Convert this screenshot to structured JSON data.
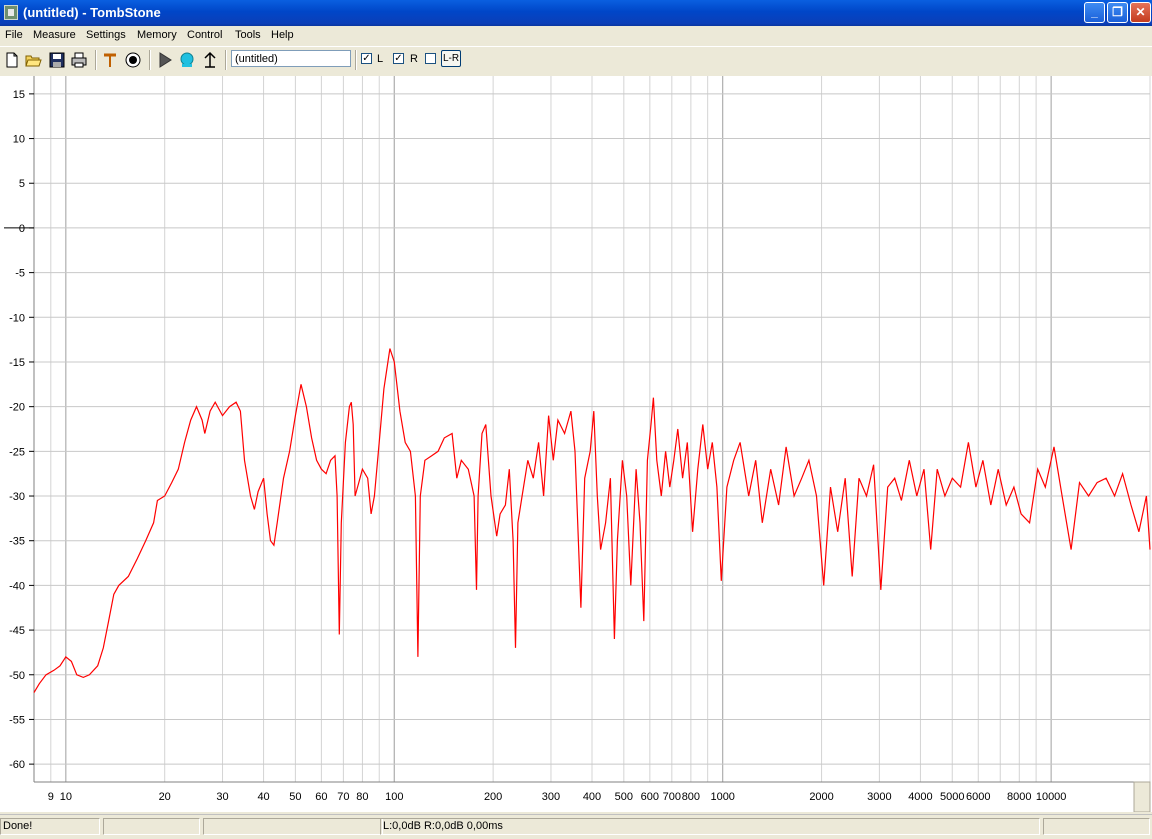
{
  "window": {
    "title": "(untitled) - TombStone",
    "minimize_glyph": "_",
    "restore_glyph": "❐",
    "close_glyph": "✕"
  },
  "menu": [
    "File",
    "Measure",
    "Settings",
    "Memory",
    "Control",
    "Tools",
    "Help"
  ],
  "toolbar": {
    "icons": [
      "new-file-icon",
      "open-folder-icon",
      "save-disk-icon",
      "print-icon",
      "probe-icon",
      "target-icon",
      "play-icon",
      "record-icon",
      "antenna-icon"
    ],
    "name_value": "(untitled)",
    "check_l_label": "L",
    "check_l_checked": true,
    "check_r_label": "R",
    "check_r_checked": true,
    "check_lr_checked": false,
    "lr_button_label": "L-R",
    "checkmark": "✓"
  },
  "status": {
    "left": "Done!",
    "middle": "",
    "readout": "L:0,0dB R:0,0dB 0,00ms"
  },
  "chart_data": {
    "type": "line",
    "x_scale": "log",
    "xlim": [
      8,
      20000
    ],
    "ylim": [
      -62,
      17
    ],
    "grid": true,
    "x_ticks": [
      9,
      10,
      20,
      30,
      40,
      50,
      60,
      70,
      80,
      100,
      200,
      300,
      400,
      500,
      600,
      700,
      800,
      1000,
      2000,
      3000,
      4000,
      5000,
      6000,
      8000,
      10000
    ],
    "x_tick_labels": [
      "9",
      "10",
      "20",
      "30",
      "40",
      "50",
      "60",
      "70",
      "80",
      "100",
      "200",
      "300",
      "400",
      "500",
      "600",
      "700",
      "800",
      "1000",
      "2000",
      "3000",
      "4000",
      "5000",
      "6000",
      "8000",
      "10000"
    ],
    "y_ticks": [
      15,
      10,
      5,
      0,
      -5,
      -10,
      -15,
      -20,
      -25,
      -30,
      -35,
      -40,
      -45,
      -50,
      -55,
      -60
    ],
    "y_tick_labels": [
      "15",
      "10",
      "5",
      "0",
      "-5",
      "-10",
      "-15",
      "-20",
      "-25",
      "-30",
      "-35",
      "-40",
      "-45",
      "-50",
      "-55",
      "-60"
    ],
    "series": [
      {
        "color": "#ff0000",
        "points": [
          [
            8.0,
            -52.0
          ],
          [
            8.3,
            -51.0
          ],
          [
            8.7,
            -50.0
          ],
          [
            9.2,
            -49.5
          ],
          [
            9.6,
            -49.0
          ],
          [
            10.0,
            -48.0
          ],
          [
            10.4,
            -48.5
          ],
          [
            10.8,
            -50.0
          ],
          [
            11.3,
            -50.3
          ],
          [
            11.8,
            -50.0
          ],
          [
            12.5,
            -49.0
          ],
          [
            13.0,
            -47.0
          ],
          [
            13.5,
            -44.0
          ],
          [
            14.0,
            -41.0
          ],
          [
            14.5,
            -40.0
          ],
          [
            15.5,
            -39.0
          ],
          [
            16.5,
            -37.0
          ],
          [
            17.5,
            -35.0
          ],
          [
            18.5,
            -33.0
          ],
          [
            19.0,
            -30.5
          ],
          [
            20.0,
            -30.0
          ],
          [
            21.0,
            -28.5
          ],
          [
            22.0,
            -27.0
          ],
          [
            23.0,
            -24.0
          ],
          [
            24.0,
            -21.5
          ],
          [
            25.0,
            -20.0
          ],
          [
            26.0,
            -21.5
          ],
          [
            26.5,
            -23.0
          ],
          [
            27.5,
            -20.5
          ],
          [
            28.5,
            -19.5
          ],
          [
            30.0,
            -21.0
          ],
          [
            31.5,
            -20.0
          ],
          [
            33.0,
            -19.5
          ],
          [
            34.0,
            -20.5
          ],
          [
            35.0,
            -26.0
          ],
          [
            36.5,
            -30.0
          ],
          [
            37.5,
            -31.5
          ],
          [
            38.5,
            -29.5
          ],
          [
            40.0,
            -28.0
          ],
          [
            41.0,
            -32.0
          ],
          [
            42.0,
            -35.0
          ],
          [
            43.0,
            -35.5
          ],
          [
            44.0,
            -33.0
          ],
          [
            46.0,
            -28.0
          ],
          [
            48.0,
            -25.0
          ],
          [
            50.0,
            -21.0
          ],
          [
            52.0,
            -17.5
          ],
          [
            54.0,
            -20.0
          ],
          [
            56.0,
            -23.5
          ],
          [
            58.0,
            -26.0
          ],
          [
            60.0,
            -27.0
          ],
          [
            62.0,
            -27.5
          ],
          [
            64.0,
            -26.0
          ],
          [
            66.0,
            -25.5
          ],
          [
            67.0,
            -30.0
          ],
          [
            68.0,
            -45.5
          ],
          [
            69.0,
            -33.0
          ],
          [
            71.0,
            -24.0
          ],
          [
            73.0,
            -20.0
          ],
          [
            74.0,
            -19.5
          ],
          [
            75.0,
            -22.0
          ],
          [
            76.0,
            -30.0
          ],
          [
            78.0,
            -28.5
          ],
          [
            80.0,
            -27.0
          ],
          [
            83.0,
            -28.0
          ],
          [
            85.0,
            -32.0
          ],
          [
            87.0,
            -30.0
          ],
          [
            90.0,
            -24.0
          ],
          [
            93.0,
            -18.0
          ],
          [
            97.0,
            -13.5
          ],
          [
            100.0,
            -15.0
          ],
          [
            104.0,
            -20.5
          ],
          [
            108.0,
            -24.0
          ],
          [
            112.0,
            -25.0
          ],
          [
            116.0,
            -30.0
          ],
          [
            118.0,
            -48.0
          ],
          [
            120.0,
            -30.0
          ],
          [
            124.0,
            -26.0
          ],
          [
            130.0,
            -25.5
          ],
          [
            136.0,
            -25.0
          ],
          [
            142.0,
            -23.5
          ],
          [
            150.0,
            -23.0
          ],
          [
            155.0,
            -28.0
          ],
          [
            160.0,
            -26.0
          ],
          [
            168.0,
            -27.0
          ],
          [
            175.0,
            -30.0
          ],
          [
            178.0,
            -40.5
          ],
          [
            180.0,
            -30.0
          ],
          [
            185.0,
            -23.0
          ],
          [
            190.0,
            -22.0
          ],
          [
            197.0,
            -30.0
          ],
          [
            205.0,
            -34.5
          ],
          [
            210.0,
            -32.0
          ],
          [
            218.0,
            -31.0
          ],
          [
            224.0,
            -27.0
          ],
          [
            230.0,
            -35.0
          ],
          [
            234.0,
            -47.0
          ],
          [
            238.0,
            -33.0
          ],
          [
            245.0,
            -30.0
          ],
          [
            255.0,
            -26.0
          ],
          [
            265.0,
            -28.0
          ],
          [
            275.0,
            -24.0
          ],
          [
            285.0,
            -30.0
          ],
          [
            295.0,
            -21.0
          ],
          [
            305.0,
            -26.0
          ],
          [
            315.0,
            -21.5
          ],
          [
            330.0,
            -23.0
          ],
          [
            345.0,
            -20.5
          ],
          [
            355.0,
            -25.0
          ],
          [
            370.0,
            -42.5
          ],
          [
            380.0,
            -28.0
          ],
          [
            395.0,
            -25.0
          ],
          [
            405.0,
            -20.5
          ],
          [
            415.0,
            -30.0
          ],
          [
            425.0,
            -36.0
          ],
          [
            440.0,
            -33.0
          ],
          [
            455.0,
            -28.0
          ],
          [
            468.0,
            -46.0
          ],
          [
            478.0,
            -35.0
          ],
          [
            495.0,
            -26.0
          ],
          [
            510.0,
            -30.0
          ],
          [
            525.0,
            -40.0
          ],
          [
            545.0,
            -27.0
          ],
          [
            560.0,
            -33.0
          ],
          [
            575.0,
            -44.0
          ],
          [
            590.0,
            -26.0
          ],
          [
            605.0,
            -22.0
          ],
          [
            615.0,
            -19.0
          ],
          [
            630.0,
            -26.0
          ],
          [
            650.0,
            -30.0
          ],
          [
            670.0,
            -25.0
          ],
          [
            690.0,
            -29.0
          ],
          [
            710.0,
            -26.0
          ],
          [
            730.0,
            -22.5
          ],
          [
            755.0,
            -28.0
          ],
          [
            780.0,
            -24.0
          ],
          [
            810.0,
            -34.0
          ],
          [
            840.0,
            -27.0
          ],
          [
            870.0,
            -22.0
          ],
          [
            900.0,
            -27.0
          ],
          [
            930.0,
            -24.0
          ],
          [
            960.0,
            -29.0
          ],
          [
            990.0,
            -39.5
          ],
          [
            1030.0,
            -29.0
          ],
          [
            1080.0,
            -26.0
          ],
          [
            1130.0,
            -24.0
          ],
          [
            1200.0,
            -30.0
          ],
          [
            1260.0,
            -26.0
          ],
          [
            1320.0,
            -33.0
          ],
          [
            1400.0,
            -27.0
          ],
          [
            1480.0,
            -31.0
          ],
          [
            1560.0,
            -24.5
          ],
          [
            1650.0,
            -30.0
          ],
          [
            1740.0,
            -28.0
          ],
          [
            1830.0,
            -26.0
          ],
          [
            1930.0,
            -30.0
          ],
          [
            2030.0,
            -40.0
          ],
          [
            2130.0,
            -29.0
          ],
          [
            2240.0,
            -34.0
          ],
          [
            2360.0,
            -28.0
          ],
          [
            2480.0,
            -39.0
          ],
          [
            2600.0,
            -28.0
          ],
          [
            2740.0,
            -30.0
          ],
          [
            2880.0,
            -26.5
          ],
          [
            3030.0,
            -40.5
          ],
          [
            3180.0,
            -29.0
          ],
          [
            3340.0,
            -28.0
          ],
          [
            3500.0,
            -30.5
          ],
          [
            3700.0,
            -26.0
          ],
          [
            3900.0,
            -30.0
          ],
          [
            4100.0,
            -27.0
          ],
          [
            4300.0,
            -36.0
          ],
          [
            4500.0,
            -27.0
          ],
          [
            4750.0,
            -30.0
          ],
          [
            5000.0,
            -28.0
          ],
          [
            5300.0,
            -29.0
          ],
          [
            5600.0,
            -24.0
          ],
          [
            5900.0,
            -29.0
          ],
          [
            6200.0,
            -26.0
          ],
          [
            6550.0,
            -31.0
          ],
          [
            6900.0,
            -27.0
          ],
          [
            7300.0,
            -31.0
          ],
          [
            7700.0,
            -29.0
          ],
          [
            8100.0,
            -32.0
          ],
          [
            8600.0,
            -33.0
          ],
          [
            9100.0,
            -27.0
          ],
          [
            9600.0,
            -29.0
          ],
          [
            10200.0,
            -24.5
          ],
          [
            10800.0,
            -30.0
          ],
          [
            11500.0,
            -36.0
          ],
          [
            12200.0,
            -28.5
          ],
          [
            13000.0,
            -30.0
          ],
          [
            13800.0,
            -28.5
          ],
          [
            14700.0,
            -28.0
          ],
          [
            15600.0,
            -30.0
          ],
          [
            16500.0,
            -27.5
          ],
          [
            17500.0,
            -31.0
          ],
          [
            18500.0,
            -34.0
          ],
          [
            19500.0,
            -30.0
          ],
          [
            20000.0,
            -36.0
          ]
        ]
      }
    ]
  }
}
